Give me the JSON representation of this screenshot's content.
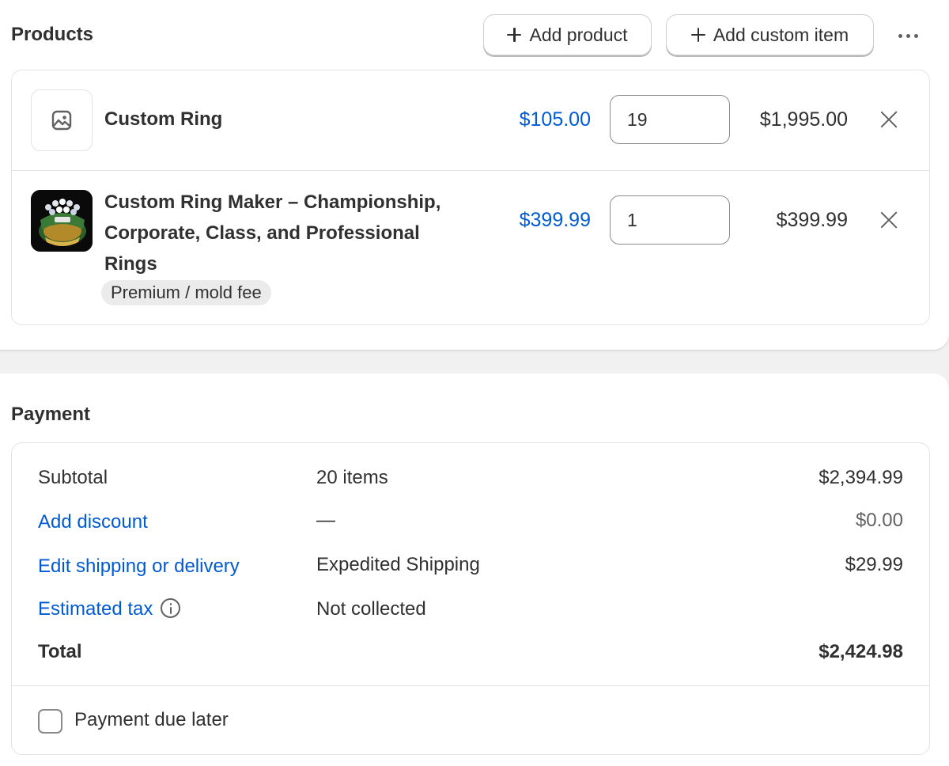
{
  "products": {
    "title": "Products",
    "add_product_label": "Add product",
    "add_custom_item_label": "Add custom item",
    "items": [
      {
        "name": "Custom Ring",
        "unit_price": "$105.00",
        "quantity": "19",
        "total": "$1,995.00",
        "thumbnail_icon": "image-placeholder-icon"
      },
      {
        "name": "Custom Ring Maker – Championship, Corporate, Class, and Professional Rings",
        "variant": "Premium / mold fee",
        "unit_price": "$399.99",
        "quantity": "1",
        "total": "$399.99"
      }
    ]
  },
  "payment": {
    "title": "Payment",
    "rows": [
      {
        "label": "Subtotal",
        "detail": "20 items",
        "amount": "$2,394.99"
      },
      {
        "label": "Add discount",
        "detail": "—",
        "amount": "$0.00"
      },
      {
        "label": "Edit shipping or delivery",
        "detail": "Expedited Shipping",
        "amount": "$29.99"
      },
      {
        "label": "Estimated tax",
        "detail": "Not collected",
        "amount": ""
      },
      {
        "label": "Total",
        "detail": "",
        "amount": "$2,424.98"
      }
    ],
    "payment_due_later_label": "Payment due later",
    "payment_due_later_checked": false
  },
  "colors": {
    "link": "#005bd3",
    "text": "#303030",
    "muted": "#616161",
    "border": "#e3e3e3",
    "background": "#f1f1f1"
  }
}
